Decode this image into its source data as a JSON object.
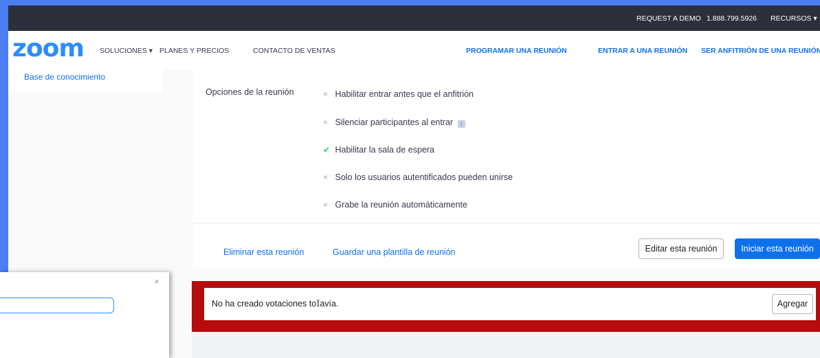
{
  "topbar": {
    "request_demo": "REQUEST A DEMO",
    "phone": "1.888.799.5926",
    "resources": "RECURSOS ▾"
  },
  "nav": {
    "logo": "zoom",
    "solutions": "SOLUCIONES ▾",
    "plans": "PLANES Y PRECIOS",
    "contact": "CONTACTO DE VENTAS",
    "schedule": "PROGRAMAR UNA REUNIÓN",
    "join": "ENTRAR A UNA REUNIÓN",
    "host": "SER ANFITRIÓN DE UNA REUNIÓN"
  },
  "sidebar": {
    "knowledge_base": "Base de conocimiento"
  },
  "meeting_options": {
    "label": "Opciones de la reunión",
    "items": [
      {
        "text": "Habilitar entrar antes que el anfitrión",
        "enabled": false
      },
      {
        "text": "Silenciar participantes al entrar",
        "enabled": false
      },
      {
        "text": "Habilitar la sala de espera",
        "enabled": true
      },
      {
        "text": "Solo los usuarios autentificados pueden unirse",
        "enabled": false
      },
      {
        "text": "Grabe la reunión automáticamente",
        "enabled": false
      }
    ]
  },
  "actions": {
    "delete": "Eliminar esta reunión",
    "save_template": "Guardar una plantilla de reunión",
    "edit": "Editar esta reunión",
    "start": "Iniciar esta reunión"
  },
  "polls": {
    "message_a": "No ha creado votaciones to",
    "message_b": "avía.",
    "add": "Agregar"
  },
  "dialog": {
    "close": "×"
  },
  "colors": {
    "accent": "#0e71eb",
    "highlight_frame": "#b50d0d",
    "check": "#23d959",
    "backdrop": "#4a7ef2"
  }
}
